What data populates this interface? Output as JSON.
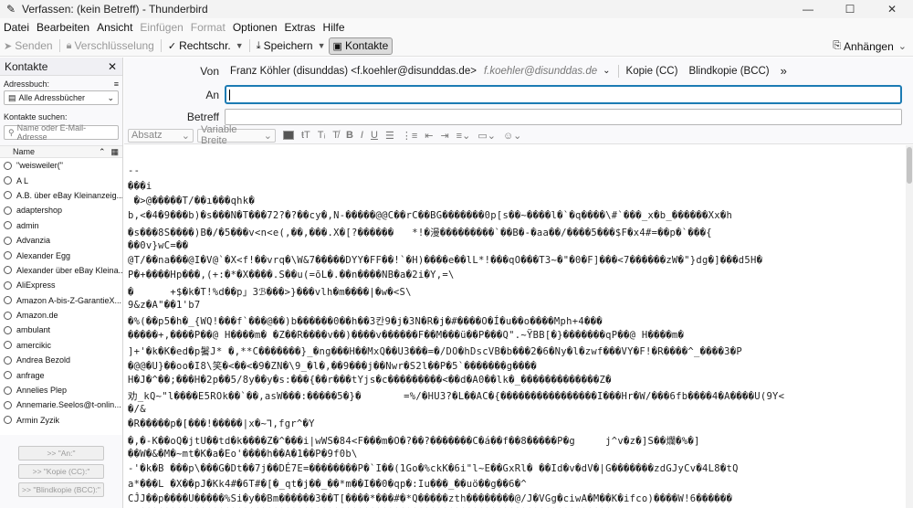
{
  "window": {
    "title": "Verfassen: (kein Betreff) - Thunderbird",
    "minimize": "—",
    "maximize": "☐",
    "close": "✕"
  },
  "menu": [
    {
      "label": "Datei",
      "enabled": true
    },
    {
      "label": "Bearbeiten",
      "enabled": true
    },
    {
      "label": "Ansicht",
      "enabled": true
    },
    {
      "label": "Einfügen",
      "enabled": false
    },
    {
      "label": "Format",
      "enabled": false
    },
    {
      "label": "Optionen",
      "enabled": true
    },
    {
      "label": "Extras",
      "enabled": true
    },
    {
      "label": "Hilfe",
      "enabled": true
    }
  ],
  "toolbar": {
    "send": "Senden",
    "encryption": "Verschlüsselung",
    "spelling": "Rechtschr.",
    "save": "Speichern",
    "contacts": "Kontakte",
    "attachments": "Anhängen"
  },
  "sidebar": {
    "title": "Kontakte",
    "addressbook_label": "Adressbuch:",
    "addressbook_value": "Alle Adressbücher",
    "search_label": "Kontakte suchen:",
    "search_placeholder": "Name oder E-Mail-Adresse",
    "column_name": "Name",
    "contacts": [
      "\"weisweiler(\"",
      "A L",
      "A.B. über eBay Kleinanzeig...",
      "adaptershop",
      "admin",
      "Advanzia",
      "Alexander Egg",
      "Alexander über eBay Kleina...",
      "AliExpress",
      "Amazon A-bis-Z-GarantieX...",
      "Amazon.de",
      "ambulant",
      "amercikic",
      "Andrea Bezold",
      "anfrage",
      "Annelies Plep",
      "Annemarie.Seelos@t-onlin...",
      "Armin Zyzik"
    ],
    "btn_to": ">> \"An:\"",
    "btn_cc": ">> \"Kopie (CC):\"",
    "btn_bcc": ">> \"Blindkopie (BCC):\""
  },
  "header": {
    "from_label": "Von",
    "from_name": "Franz Köhler (disunddas) <f.koehler@disunddas.de>",
    "from_email": "f.koehler@disunddas.de",
    "cc": "Kopie (CC)",
    "bcc": "Blindkopie (BCC)",
    "more": "»",
    "to_label": "An",
    "to_value": "",
    "subject_label": "Betreff",
    "subject_value": ""
  },
  "format": {
    "paragraph": "Absatz",
    "font": "Variable Breite"
  },
  "body_lines": [
    "",
    "--",
    "���i",
    " �>@�����T/��ı���qhk�",
    "b,<�4�9���b)�s���N�T���72?�?��cy�,N-�����@@C��rC��BG�������0p[s��~����l�`�q����\\#`���_x�b_������Xx�h",
    "�s���8S����)B�/�5���v<n<e(,��,���.X�[?������   *!�漫���������`��B�-�aa��/����5���$F�x4#=��p�`���{",
    "��0v}wC=��",
    "@T/��na���@I�V@`�X<f!��vrq�\\W&7�����DYY�FF��!`�H)����e��lL*!���qO���T3~�\"�0�F]���<7������zW�\"}dg�]���d5H�",
    "P�+����Hp���,(+:�*�X����.S��u(=ōL�.��n����NB�a�2i�Y,=\\",
    "�      +$�k�T!%d��p」3ℬ���>}���vlh�m����|�w�<S\\",
    "9&z�A\"��1'b7",
    "�%(��p5�h�_{WQ!���f`���@��)b������0��h��3칸9�j�3N�R�j�#����O�Í�u��o����Mph+4���",
    "�����+,����P��@ H����m� �Z��R����v��)����v������F��M���ü��P���Q\".~ŸBB[�}�������qP��@ H����m� ",
    "]+'�k�K�ed�p鬐J* �,**C�������}_�ng���H��MxQ��U3���=�/DO�hDscVB�b���2�6�Ny�l�zwf���VY�F!�R����^_����3�P",
    "�@@�U}��oo�I8\\笑�<��<�9�ZN�\\9_�l�,��9���j��Nwr�S2l��P�5`�������g����",
    "H�J�^��;���H�2p��5/8y��y�s:���{��r���tYjs�c���������<��d�A0��lk�_�������������Z�",
    "劝_kQ~\"l����E5ROk��`��,asW���:�����5�}�       =%/�HU3?�L��AC�{����������������I���Hr�W/���6fb����4�A����U(9Y<",
    "�/&",
    "�R�����p�[���!�����|x�~⅂,fgr^�Y",
    "�,�-K��oQ�jtU��td�k����Z�^���i|wWS�84<F���m�O�?��?�������C�á��f��8�����P�g     j^v�z�]S��爛�%�]",
    "��W�&�M�~mt�K�a�Eo'����h��A�1��P�9f0b\\",
    "-'�k�B ���p\\���G�Dt��7j��DÉ7E=��������P�`I��(1Go�%ckK�6i\"l~E��GxRl� ��Id�v�dV�|G�������zdGJyCv�4L8�tQ",
    "a*���L �X��pJ�Kk4#�6T#�[�_qt�j��_��*m��I��0�qp�:Iu���_��uö��g��6�^",
    "CĴJ��p����U�����%Si�y��Bm������3��T[����*���#�*Q�����zth��������@/J�VGg�ciwA�M��K�ifco)����W!6������",
    "J*������������������������������������������������������������������������������"
  ]
}
